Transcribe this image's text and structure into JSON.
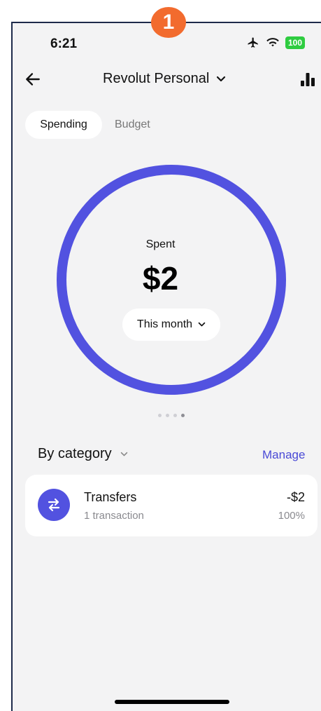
{
  "step_badge": "1",
  "status_bar": {
    "time": "6:21",
    "battery": "100"
  },
  "header": {
    "account_name": "Revolut Personal"
  },
  "tabs": [
    {
      "label": "Spending",
      "active": true
    },
    {
      "label": "Budget",
      "active": false
    }
  ],
  "summary": {
    "label": "Spent",
    "amount": "$2",
    "period": "This month",
    "carousel_page": 4,
    "carousel_pages": 4
  },
  "section": {
    "title": "By category",
    "action": "Manage"
  },
  "categories": [
    {
      "name": "Transfers",
      "subtitle": "1 transaction",
      "amount": "-$2",
      "percent": "100%",
      "icon": "transfer-arrows-icon"
    }
  ],
  "colors": {
    "accent": "#5252e0",
    "ring": "#5252e0",
    "link": "#4a4ad6",
    "badge": "#f26b2e",
    "battery": "#2ecc40"
  }
}
